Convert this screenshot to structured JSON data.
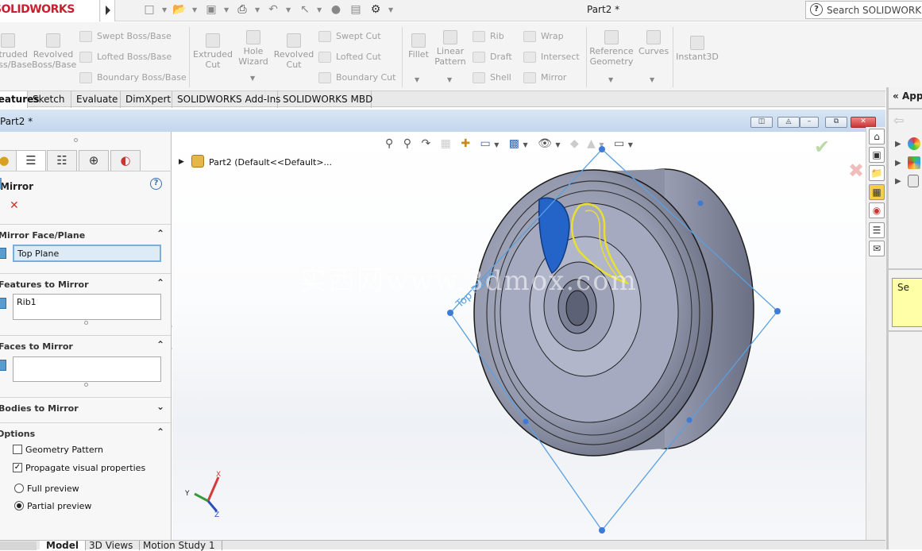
{
  "app": {
    "logo_text": "SOLIDWORKS",
    "document_title": "Part2 *",
    "search_placeholder": "Search SOLIDWORKS He"
  },
  "ribbon": {
    "buttons": [
      {
        "label": "Extruded Boss/Base",
        "icon": "extrude-boss-icon"
      },
      {
        "label": "Revolved Boss/Base",
        "icon": "revolve-boss-icon"
      },
      {
        "label": "Extruded Cut",
        "icon": "extrude-cut-icon"
      },
      {
        "label": "Hole Wizard",
        "icon": "hole-wizard-icon"
      },
      {
        "label": "Revolved Cut",
        "icon": "revolve-cut-icon"
      },
      {
        "label": "Fillet",
        "icon": "fillet-icon"
      },
      {
        "label": "Linear Pattern",
        "icon": "linear-pattern-icon"
      },
      {
        "label": "Reference Geometry",
        "icon": "reference-geometry-icon"
      },
      {
        "label": "Curves",
        "icon": "curves-icon"
      },
      {
        "label": "Instant3D",
        "icon": "instant3d-icon"
      }
    ],
    "small_buttons": {
      "swept_boss": "Swept Boss/Base",
      "lofted_boss": "Lofted Boss/Base",
      "boundary_boss": "Boundary Boss/Base",
      "swept_cut": "Swept Cut",
      "lofted_cut": "Lofted Cut",
      "boundary_cut": "Boundary Cut",
      "rib": "Rib",
      "draft": "Draft",
      "shell": "Shell",
      "wrap": "Wrap",
      "intersect": "Intersect",
      "mirror": "Mirror"
    }
  },
  "command_tabs": [
    "Features",
    "Sketch",
    "Evaluate",
    "DimXpert",
    "SOLIDWORKS Add-Ins",
    "SOLIDWORKS MBD"
  ],
  "document_window": {
    "title": "Part2 *"
  },
  "property_manager": {
    "title": "Mirror",
    "sections": {
      "mirror_face_plane": {
        "label": "Mirror Face/Plane",
        "value": "Top Plane"
      },
      "features_to_mirror": {
        "label": "Features to Mirror",
        "value": "Rib1"
      },
      "faces_to_mirror": {
        "label": "Faces to Mirror",
        "value": ""
      },
      "bodies_to_mirror": {
        "label": "Bodies to Mirror"
      },
      "options": {
        "label": "Options",
        "geometry_pattern": {
          "label": "Geometry Pattern",
          "checked": false
        },
        "propagate_visual": {
          "label": "Propagate visual properties",
          "checked": true
        },
        "full_preview": {
          "label": "Full preview",
          "selected": false
        },
        "partial_preview": {
          "label": "Partial preview",
          "selected": true
        }
      }
    }
  },
  "feature_tree": {
    "root": "Part2 (Default<<Default>..."
  },
  "viewport": {
    "watermark": "实西网www.3dmox.com",
    "plane_label": "Top Plane"
  },
  "right_panel": {
    "title": "Appe",
    "tooltip_text": "Se"
  },
  "bottom_tabs": [
    "Model",
    "3D Views",
    "Motion Study 1"
  ],
  "colors": {
    "accent": "#3d7bd4",
    "plane": "#5aa0e0",
    "preview": "#e8e030",
    "part": "#8f93a6"
  }
}
